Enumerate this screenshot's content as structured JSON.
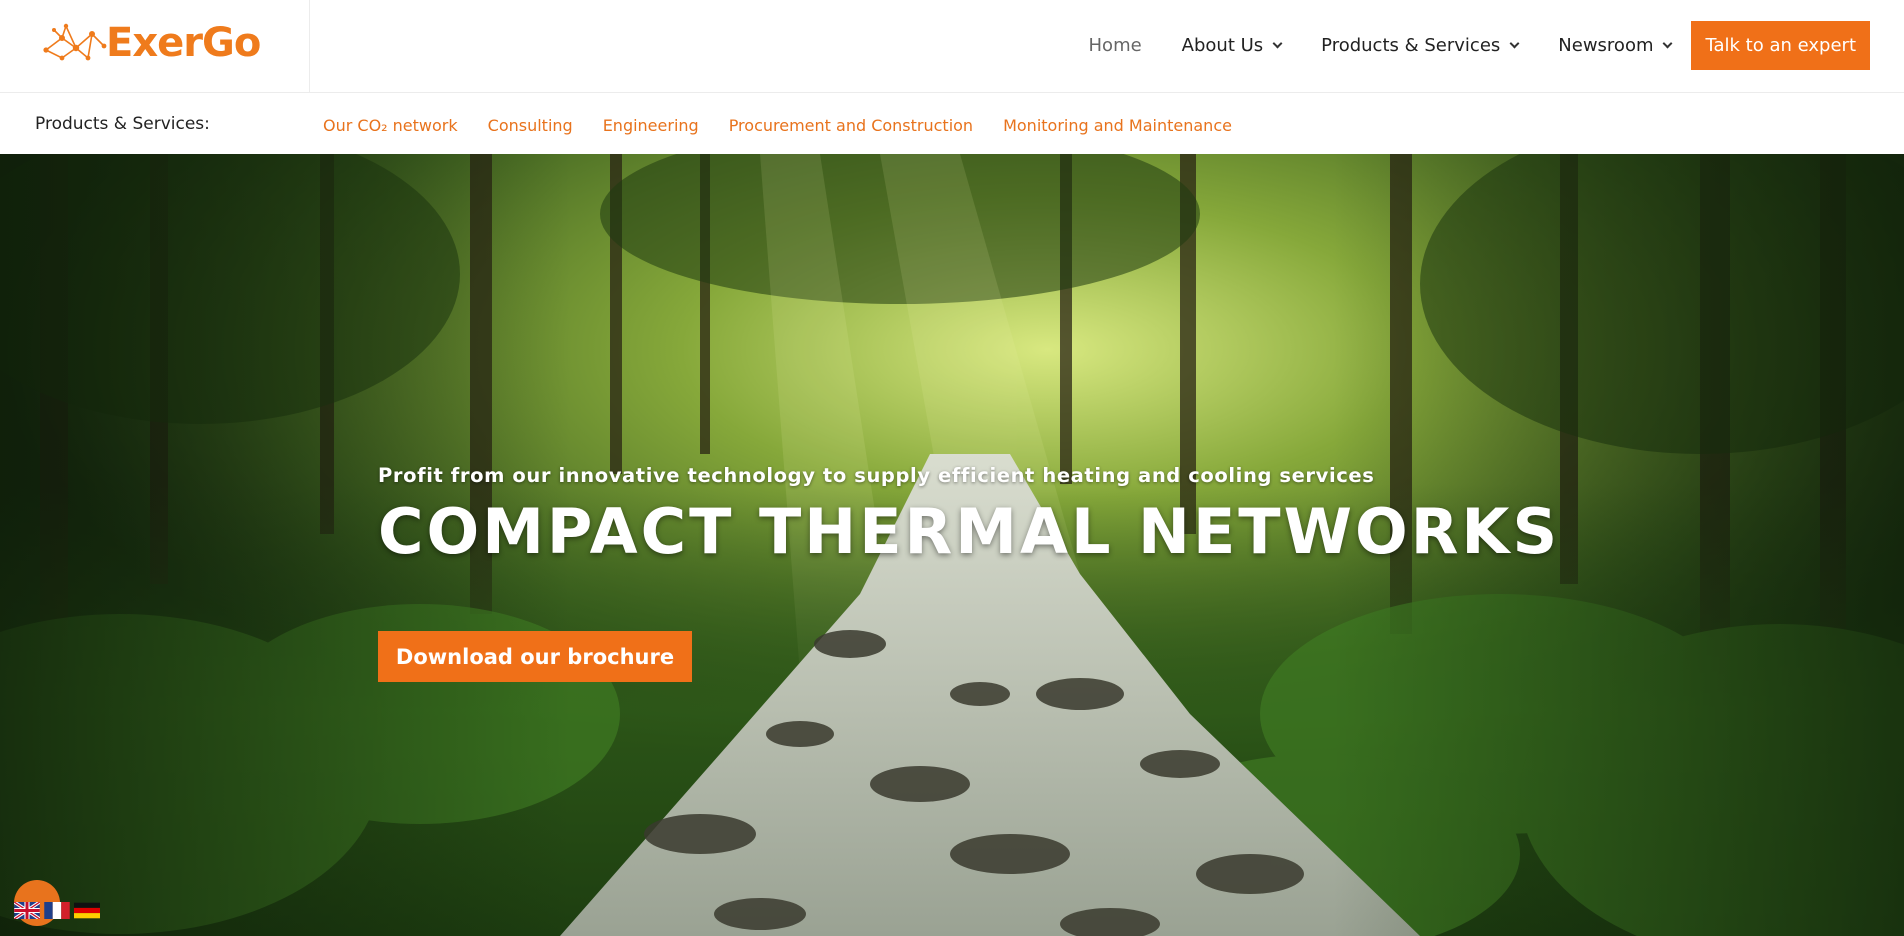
{
  "brand": {
    "name": "ExerGo",
    "accent": "#f07018",
    "link_color": "#e8731d"
  },
  "main_nav": {
    "items": [
      {
        "label": "Home",
        "has_dropdown": false
      },
      {
        "label": "About Us",
        "has_dropdown": true
      },
      {
        "label": "Products & Services",
        "has_dropdown": true
      },
      {
        "label": "Newsroom",
        "has_dropdown": true
      }
    ],
    "cta_label": "Talk to an expert"
  },
  "sub_nav": {
    "label": "Products & Services:",
    "links": [
      "Our CO₂ network",
      "Consulting",
      "Engineering",
      "Procurement and Construction",
      "Monitoring and Maintenance"
    ]
  },
  "hero": {
    "kicker": "Profit from our innovative technology to supply efficient heating and cooling services",
    "title": "COMPACT THERMAL NETWORKS",
    "button_label": "Download our brochure"
  },
  "language_switcher": {
    "languages": [
      "English",
      "Français",
      "Deutsch"
    ],
    "icons": [
      "uk-flag-icon",
      "france-flag-icon",
      "germany-flag-icon"
    ]
  }
}
